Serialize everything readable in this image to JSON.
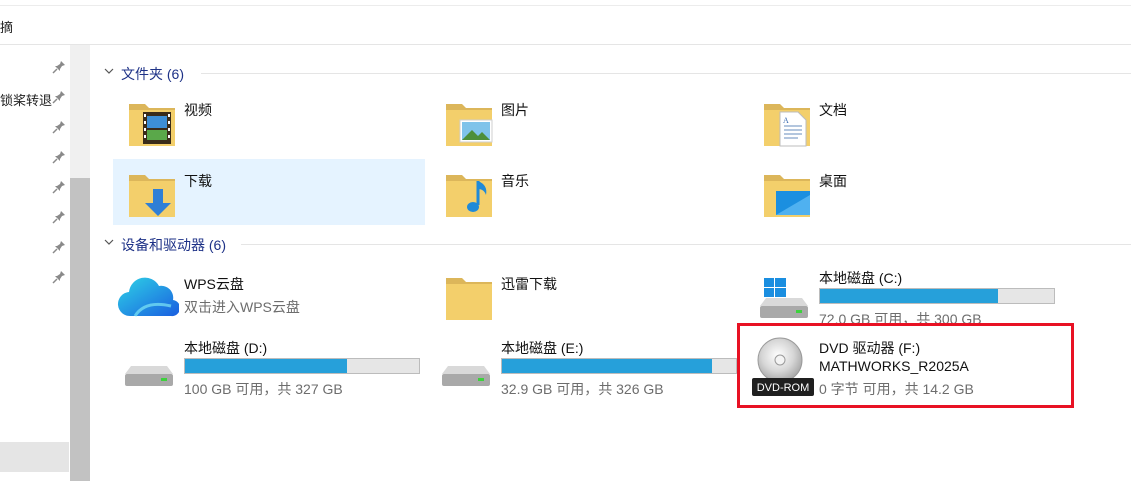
{
  "window": {
    "title_partial": "摘"
  },
  "nav": {
    "items": [
      {
        "label": ""
      },
      {
        "label": "锁桨转退"
      },
      {
        "label": ""
      },
      {
        "label": ""
      },
      {
        "label": ""
      },
      {
        "label": ""
      },
      {
        "label": ""
      },
      {
        "label": ""
      }
    ]
  },
  "groups": {
    "folders": {
      "title": "文件夹 (6)"
    },
    "devices": {
      "title": "设备和驱动器 (6)"
    }
  },
  "folders": [
    {
      "name": "视频",
      "icon": "video-folder-icon"
    },
    {
      "name": "图片",
      "icon": "pictures-folder-icon"
    },
    {
      "name": "文档",
      "icon": "documents-folder-icon"
    },
    {
      "name": "下载",
      "icon": "downloads-folder-icon"
    },
    {
      "name": "音乐",
      "icon": "music-folder-icon"
    },
    {
      "name": "桌面",
      "icon": "desktop-folder-icon"
    }
  ],
  "devices": {
    "wps": {
      "name": "WPS云盘",
      "sub": "双击进入WPS云盘"
    },
    "xunlei": {
      "name": "迅雷下载"
    },
    "c": {
      "name": "本地磁盘 (C:)",
      "free": "72.0 GB 可用，共 300 GB",
      "used_fraction": 0.76
    },
    "d": {
      "name": "本地磁盘 (D:)",
      "free": "100 GB 可用，共 327 GB",
      "used_fraction": 0.694
    },
    "e": {
      "name": "本地磁盘 (E:)",
      "free": "32.9 GB 可用，共 326 GB",
      "used_fraction": 0.899
    },
    "f": {
      "name": "DVD 驱动器 (F:)",
      "label": "MATHWORKS_R2025A",
      "free": "0 字节 可用，共 14.2 GB",
      "badge": "DVD-ROM"
    }
  },
  "colors": {
    "selected_bg": "#e5f3ff",
    "group_title": "#1e3287",
    "drive_fill": "#26a0da",
    "highlight": "#e81123"
  }
}
